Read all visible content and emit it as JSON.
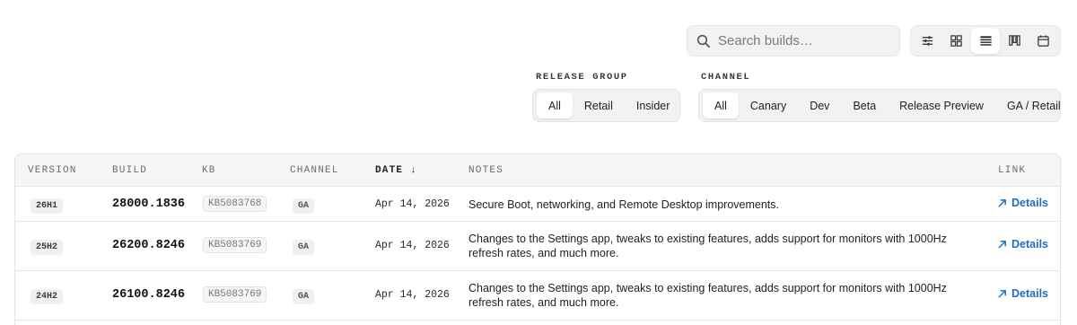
{
  "search": {
    "placeholder": "Search builds…"
  },
  "views": [
    {
      "icon": "sliders-icon",
      "active": false
    },
    {
      "icon": "grid-icon",
      "active": false
    },
    {
      "icon": "list-icon",
      "active": true
    },
    {
      "icon": "columns-icon",
      "active": false
    },
    {
      "icon": "calendar-icon",
      "active": false
    }
  ],
  "filters": {
    "release_group_label": "RELEASE GROUP",
    "release_group": [
      "All",
      "Retail",
      "Insider"
    ],
    "release_group_selected": "All",
    "channel_label": "CHANNEL",
    "channel": [
      "All",
      "Canary",
      "Dev",
      "Beta",
      "Release Preview",
      "GA / Retail"
    ],
    "channel_selected": "All"
  },
  "table": {
    "headers": {
      "version": "VERSION",
      "build": "BUILD",
      "kb": "KB",
      "channel": "CHANNEL",
      "date": "DATE",
      "date_sort": "↓",
      "notes": "NOTES",
      "link": "LINK"
    },
    "rows": [
      {
        "version": "26H1",
        "build": "28000.1836",
        "kb": "KB5083768",
        "channel": "GA",
        "date": "Apr 14, 2026",
        "notes": "Secure Boot, networking, and Remote Desktop improvements.",
        "link": "Details"
      },
      {
        "version": "25H2",
        "build": "26200.8246",
        "kb": "KB5083769",
        "channel": "GA",
        "date": "Apr 14, 2026",
        "notes": "Changes to the Settings app, tweaks to existing features, adds support for monitors with 1000Hz refresh rates, and much more.",
        "link": "Details"
      },
      {
        "version": "24H2",
        "build": "26100.8246",
        "kb": "KB5083769",
        "channel": "GA",
        "date": "Apr 14, 2026",
        "notes": "Changes to the Settings app, tweaks to existing features, adds support for monitors with 1000Hz refresh rates, and much more.",
        "link": "Details"
      }
    ]
  },
  "colors": {
    "link": "#1f6fc1",
    "panel": "#f2f2f2",
    "border": "#e3e3e3"
  }
}
